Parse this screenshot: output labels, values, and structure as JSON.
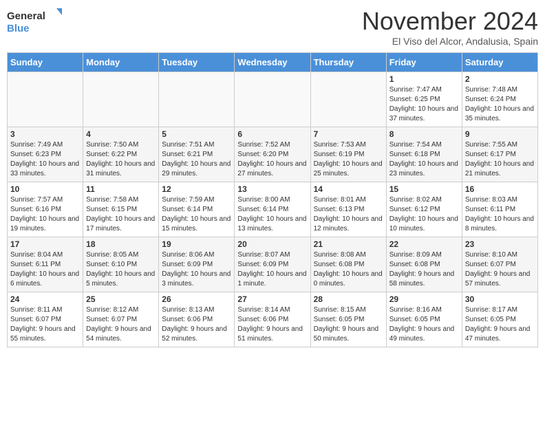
{
  "logo": {
    "general": "General",
    "blue": "Blue"
  },
  "header": {
    "month": "November 2024",
    "location": "El Viso del Alcor, Andalusia, Spain"
  },
  "weekdays": [
    "Sunday",
    "Monday",
    "Tuesday",
    "Wednesday",
    "Thursday",
    "Friday",
    "Saturday"
  ],
  "weeks": [
    [
      {
        "day": "",
        "info": ""
      },
      {
        "day": "",
        "info": ""
      },
      {
        "day": "",
        "info": ""
      },
      {
        "day": "",
        "info": ""
      },
      {
        "day": "",
        "info": ""
      },
      {
        "day": "1",
        "info": "Sunrise: 7:47 AM\nSunset: 6:25 PM\nDaylight: 10 hours and 37 minutes."
      },
      {
        "day": "2",
        "info": "Sunrise: 7:48 AM\nSunset: 6:24 PM\nDaylight: 10 hours and 35 minutes."
      }
    ],
    [
      {
        "day": "3",
        "info": "Sunrise: 7:49 AM\nSunset: 6:23 PM\nDaylight: 10 hours and 33 minutes."
      },
      {
        "day": "4",
        "info": "Sunrise: 7:50 AM\nSunset: 6:22 PM\nDaylight: 10 hours and 31 minutes."
      },
      {
        "day": "5",
        "info": "Sunrise: 7:51 AM\nSunset: 6:21 PM\nDaylight: 10 hours and 29 minutes."
      },
      {
        "day": "6",
        "info": "Sunrise: 7:52 AM\nSunset: 6:20 PM\nDaylight: 10 hours and 27 minutes."
      },
      {
        "day": "7",
        "info": "Sunrise: 7:53 AM\nSunset: 6:19 PM\nDaylight: 10 hours and 25 minutes."
      },
      {
        "day": "8",
        "info": "Sunrise: 7:54 AM\nSunset: 6:18 PM\nDaylight: 10 hours and 23 minutes."
      },
      {
        "day": "9",
        "info": "Sunrise: 7:55 AM\nSunset: 6:17 PM\nDaylight: 10 hours and 21 minutes."
      }
    ],
    [
      {
        "day": "10",
        "info": "Sunrise: 7:57 AM\nSunset: 6:16 PM\nDaylight: 10 hours and 19 minutes."
      },
      {
        "day": "11",
        "info": "Sunrise: 7:58 AM\nSunset: 6:15 PM\nDaylight: 10 hours and 17 minutes."
      },
      {
        "day": "12",
        "info": "Sunrise: 7:59 AM\nSunset: 6:14 PM\nDaylight: 10 hours and 15 minutes."
      },
      {
        "day": "13",
        "info": "Sunrise: 8:00 AM\nSunset: 6:14 PM\nDaylight: 10 hours and 13 minutes."
      },
      {
        "day": "14",
        "info": "Sunrise: 8:01 AM\nSunset: 6:13 PM\nDaylight: 10 hours and 12 minutes."
      },
      {
        "day": "15",
        "info": "Sunrise: 8:02 AM\nSunset: 6:12 PM\nDaylight: 10 hours and 10 minutes."
      },
      {
        "day": "16",
        "info": "Sunrise: 8:03 AM\nSunset: 6:11 PM\nDaylight: 10 hours and 8 minutes."
      }
    ],
    [
      {
        "day": "17",
        "info": "Sunrise: 8:04 AM\nSunset: 6:11 PM\nDaylight: 10 hours and 6 minutes."
      },
      {
        "day": "18",
        "info": "Sunrise: 8:05 AM\nSunset: 6:10 PM\nDaylight: 10 hours and 5 minutes."
      },
      {
        "day": "19",
        "info": "Sunrise: 8:06 AM\nSunset: 6:09 PM\nDaylight: 10 hours and 3 minutes."
      },
      {
        "day": "20",
        "info": "Sunrise: 8:07 AM\nSunset: 6:09 PM\nDaylight: 10 hours and 1 minute."
      },
      {
        "day": "21",
        "info": "Sunrise: 8:08 AM\nSunset: 6:08 PM\nDaylight: 10 hours and 0 minutes."
      },
      {
        "day": "22",
        "info": "Sunrise: 8:09 AM\nSunset: 6:08 PM\nDaylight: 9 hours and 58 minutes."
      },
      {
        "day": "23",
        "info": "Sunrise: 8:10 AM\nSunset: 6:07 PM\nDaylight: 9 hours and 57 minutes."
      }
    ],
    [
      {
        "day": "24",
        "info": "Sunrise: 8:11 AM\nSunset: 6:07 PM\nDaylight: 9 hours and 55 minutes."
      },
      {
        "day": "25",
        "info": "Sunrise: 8:12 AM\nSunset: 6:07 PM\nDaylight: 9 hours and 54 minutes."
      },
      {
        "day": "26",
        "info": "Sunrise: 8:13 AM\nSunset: 6:06 PM\nDaylight: 9 hours and 52 minutes."
      },
      {
        "day": "27",
        "info": "Sunrise: 8:14 AM\nSunset: 6:06 PM\nDaylight: 9 hours and 51 minutes."
      },
      {
        "day": "28",
        "info": "Sunrise: 8:15 AM\nSunset: 6:05 PM\nDaylight: 9 hours and 50 minutes."
      },
      {
        "day": "29",
        "info": "Sunrise: 8:16 AM\nSunset: 6:05 PM\nDaylight: 9 hours and 49 minutes."
      },
      {
        "day": "30",
        "info": "Sunrise: 8:17 AM\nSunset: 6:05 PM\nDaylight: 9 hours and 47 minutes."
      }
    ]
  ]
}
